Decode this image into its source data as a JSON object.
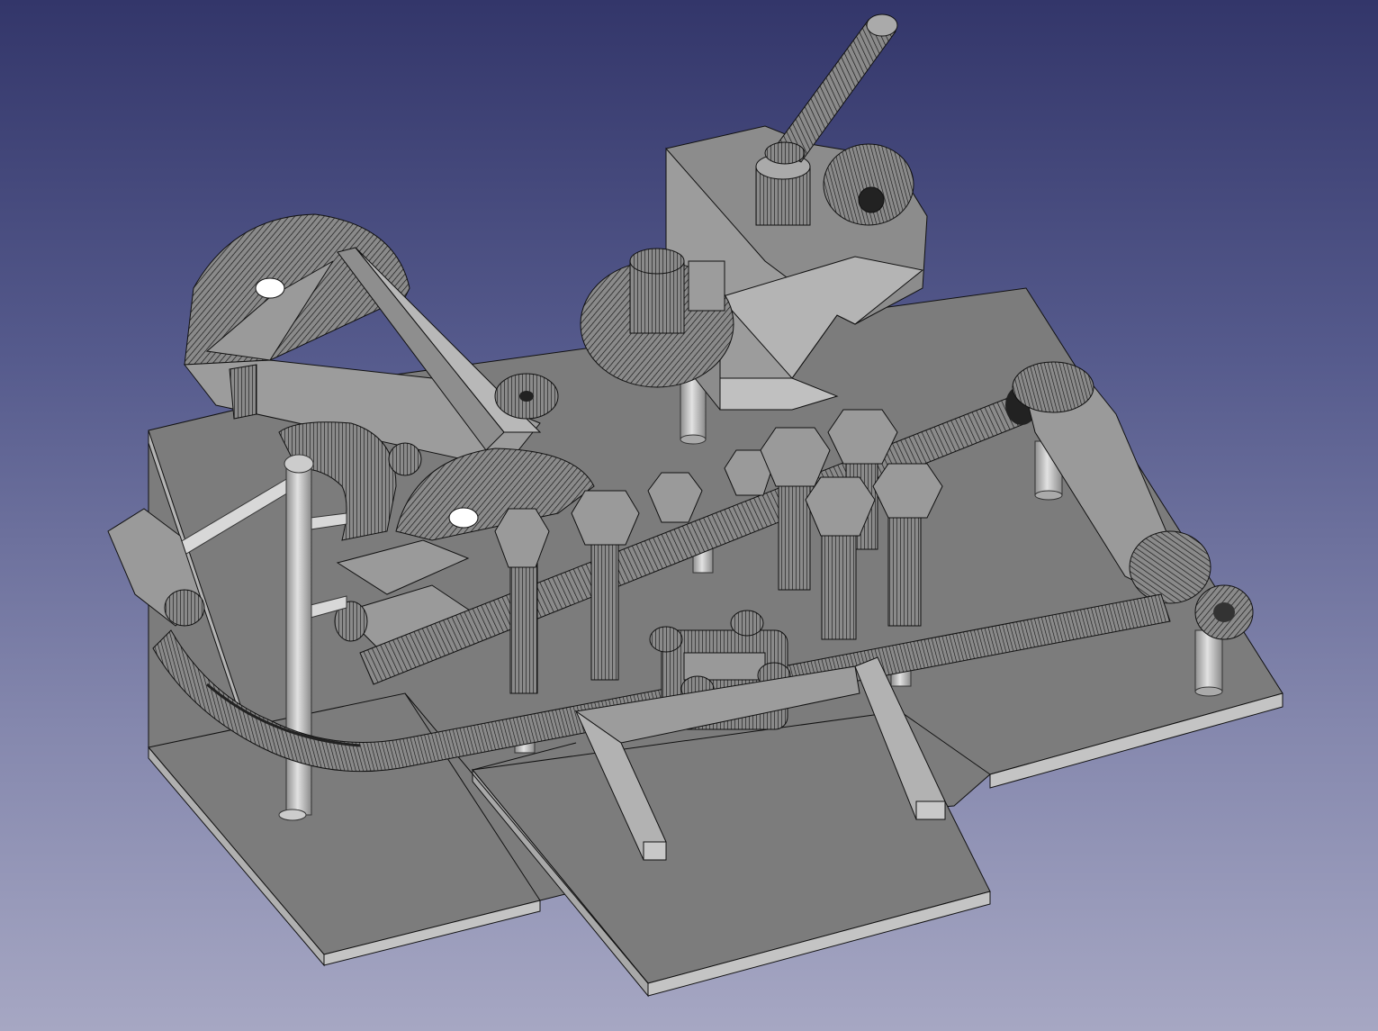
{
  "viewport": {
    "background_top": "#33366a",
    "background_bottom": "#a6a7c3",
    "shaded_face": "#7c7c7c",
    "light_face": "#c8c8c8",
    "edge": "#111111"
  },
  "model": {
    "render_style": "flat-lines wireframe",
    "parts": [
      "base-plates",
      "housing-block",
      "tilted-rod",
      "gear-fan-left",
      "gear-fan-right",
      "fan-ring",
      "bolt-heads",
      "bolt-shafts",
      "pipe-diagonal",
      "pipe-curved",
      "pipe-elbow",
      "support-posts",
      "clamp-block",
      "ramp-bracket"
    ]
  }
}
